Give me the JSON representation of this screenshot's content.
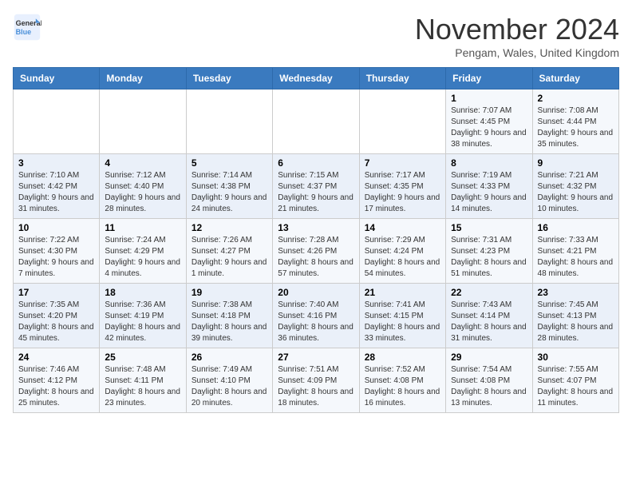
{
  "logo": {
    "text_general": "General",
    "text_blue": "Blue"
  },
  "title": "November 2024",
  "subtitle": "Pengam, Wales, United Kingdom",
  "weekdays": [
    "Sunday",
    "Monday",
    "Tuesday",
    "Wednesday",
    "Thursday",
    "Friday",
    "Saturday"
  ],
  "weeks": [
    [
      {
        "day": "",
        "info": ""
      },
      {
        "day": "",
        "info": ""
      },
      {
        "day": "",
        "info": ""
      },
      {
        "day": "",
        "info": ""
      },
      {
        "day": "",
        "info": ""
      },
      {
        "day": "1",
        "info": "Sunrise: 7:07 AM\nSunset: 4:45 PM\nDaylight: 9 hours and 38 minutes."
      },
      {
        "day": "2",
        "info": "Sunrise: 7:08 AM\nSunset: 4:44 PM\nDaylight: 9 hours and 35 minutes."
      }
    ],
    [
      {
        "day": "3",
        "info": "Sunrise: 7:10 AM\nSunset: 4:42 PM\nDaylight: 9 hours and 31 minutes."
      },
      {
        "day": "4",
        "info": "Sunrise: 7:12 AM\nSunset: 4:40 PM\nDaylight: 9 hours and 28 minutes."
      },
      {
        "day": "5",
        "info": "Sunrise: 7:14 AM\nSunset: 4:38 PM\nDaylight: 9 hours and 24 minutes."
      },
      {
        "day": "6",
        "info": "Sunrise: 7:15 AM\nSunset: 4:37 PM\nDaylight: 9 hours and 21 minutes."
      },
      {
        "day": "7",
        "info": "Sunrise: 7:17 AM\nSunset: 4:35 PM\nDaylight: 9 hours and 17 minutes."
      },
      {
        "day": "8",
        "info": "Sunrise: 7:19 AM\nSunset: 4:33 PM\nDaylight: 9 hours and 14 minutes."
      },
      {
        "day": "9",
        "info": "Sunrise: 7:21 AM\nSunset: 4:32 PM\nDaylight: 9 hours and 10 minutes."
      }
    ],
    [
      {
        "day": "10",
        "info": "Sunrise: 7:22 AM\nSunset: 4:30 PM\nDaylight: 9 hours and 7 minutes."
      },
      {
        "day": "11",
        "info": "Sunrise: 7:24 AM\nSunset: 4:29 PM\nDaylight: 9 hours and 4 minutes."
      },
      {
        "day": "12",
        "info": "Sunrise: 7:26 AM\nSunset: 4:27 PM\nDaylight: 9 hours and 1 minute."
      },
      {
        "day": "13",
        "info": "Sunrise: 7:28 AM\nSunset: 4:26 PM\nDaylight: 8 hours and 57 minutes."
      },
      {
        "day": "14",
        "info": "Sunrise: 7:29 AM\nSunset: 4:24 PM\nDaylight: 8 hours and 54 minutes."
      },
      {
        "day": "15",
        "info": "Sunrise: 7:31 AM\nSunset: 4:23 PM\nDaylight: 8 hours and 51 minutes."
      },
      {
        "day": "16",
        "info": "Sunrise: 7:33 AM\nSunset: 4:21 PM\nDaylight: 8 hours and 48 minutes."
      }
    ],
    [
      {
        "day": "17",
        "info": "Sunrise: 7:35 AM\nSunset: 4:20 PM\nDaylight: 8 hours and 45 minutes."
      },
      {
        "day": "18",
        "info": "Sunrise: 7:36 AM\nSunset: 4:19 PM\nDaylight: 8 hours and 42 minutes."
      },
      {
        "day": "19",
        "info": "Sunrise: 7:38 AM\nSunset: 4:18 PM\nDaylight: 8 hours and 39 minutes."
      },
      {
        "day": "20",
        "info": "Sunrise: 7:40 AM\nSunset: 4:16 PM\nDaylight: 8 hours and 36 minutes."
      },
      {
        "day": "21",
        "info": "Sunrise: 7:41 AM\nSunset: 4:15 PM\nDaylight: 8 hours and 33 minutes."
      },
      {
        "day": "22",
        "info": "Sunrise: 7:43 AM\nSunset: 4:14 PM\nDaylight: 8 hours and 31 minutes."
      },
      {
        "day": "23",
        "info": "Sunrise: 7:45 AM\nSunset: 4:13 PM\nDaylight: 8 hours and 28 minutes."
      }
    ],
    [
      {
        "day": "24",
        "info": "Sunrise: 7:46 AM\nSunset: 4:12 PM\nDaylight: 8 hours and 25 minutes."
      },
      {
        "day": "25",
        "info": "Sunrise: 7:48 AM\nSunset: 4:11 PM\nDaylight: 8 hours and 23 minutes."
      },
      {
        "day": "26",
        "info": "Sunrise: 7:49 AM\nSunset: 4:10 PM\nDaylight: 8 hours and 20 minutes."
      },
      {
        "day": "27",
        "info": "Sunrise: 7:51 AM\nSunset: 4:09 PM\nDaylight: 8 hours and 18 minutes."
      },
      {
        "day": "28",
        "info": "Sunrise: 7:52 AM\nSunset: 4:08 PM\nDaylight: 8 hours and 16 minutes."
      },
      {
        "day": "29",
        "info": "Sunrise: 7:54 AM\nSunset: 4:08 PM\nDaylight: 8 hours and 13 minutes."
      },
      {
        "day": "30",
        "info": "Sunrise: 7:55 AM\nSunset: 4:07 PM\nDaylight: 8 hours and 11 minutes."
      }
    ]
  ]
}
